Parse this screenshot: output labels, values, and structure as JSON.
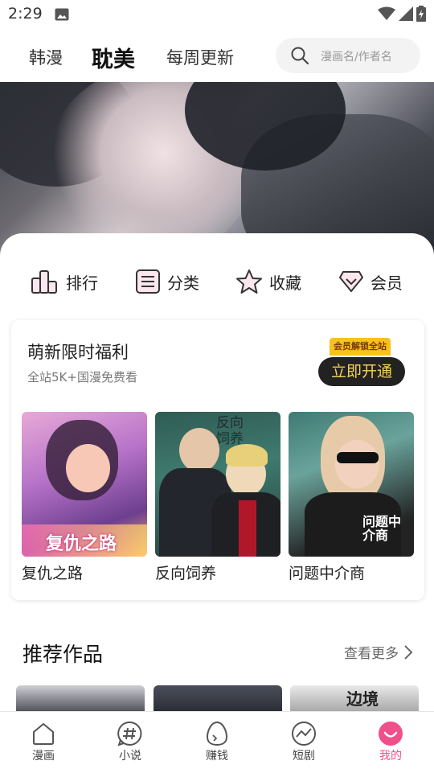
{
  "status": {
    "time": "2:29"
  },
  "top_nav": {
    "tabs": [
      "韩漫",
      "耽美",
      "每周更新"
    ],
    "active_tab": "耽美",
    "search_placeholder": "漫画名/作者名"
  },
  "quick_nav": [
    {
      "label": "排行",
      "icon": "ranking-icon"
    },
    {
      "label": "分类",
      "icon": "category-icon"
    },
    {
      "label": "收藏",
      "icon": "star-icon"
    },
    {
      "label": "会员",
      "icon": "vip-diamond-icon"
    }
  ],
  "promo": {
    "title": "萌新限时福利",
    "subtitle": "全站5K+国漫免费看",
    "badge": "会员解锁全站",
    "button": "立即开通"
  },
  "comics": [
    {
      "title": "复仇之路",
      "cover_text": "复仇之路"
    },
    {
      "title": "反向饲养",
      "cover_text": "反向饲养"
    },
    {
      "title": "问题中介商",
      "cover_text": "问题中介商"
    }
  ],
  "recommend": {
    "title": "推荐作品",
    "more": "查看更多",
    "third_cover_text": "边境"
  },
  "bottom_nav": [
    {
      "label": "漫画",
      "icon": "home-icon"
    },
    {
      "label": "小说",
      "icon": "hashtag-icon"
    },
    {
      "label": "赚钱",
      "icon": "egg-icon"
    },
    {
      "label": "短剧",
      "icon": "trend-icon"
    },
    {
      "label": "我的",
      "icon": "smile-icon",
      "active": true
    }
  ],
  "colors": {
    "accent": "#f0508a",
    "promo_gold": "#f9d35a"
  }
}
